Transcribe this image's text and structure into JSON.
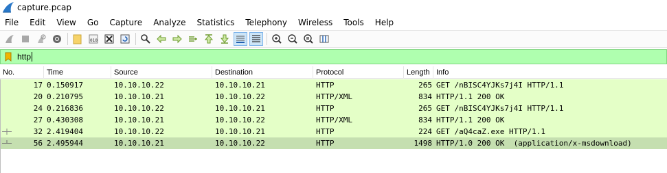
{
  "window": {
    "title": "capture.pcap"
  },
  "menu": [
    "File",
    "Edit",
    "View",
    "Go",
    "Capture",
    "Analyze",
    "Statistics",
    "Telephony",
    "Wireless",
    "Tools",
    "Help"
  ],
  "toolbar": {
    "icons": [
      "start-capture-icon",
      "stop-capture-icon",
      "restart-capture-icon",
      "capture-options-icon",
      "open-file-icon",
      "save-file-icon",
      "close-file-icon",
      "reload-file-icon",
      "find-packet-icon",
      "go-back-icon",
      "go-forward-icon",
      "go-to-packet-icon",
      "first-packet-icon",
      "last-packet-icon",
      "autoscroll-icon",
      "colorize-icon",
      "zoom-in-icon",
      "zoom-out-icon",
      "normal-size-icon",
      "resize-columns-icon"
    ]
  },
  "filter": {
    "value": "http"
  },
  "columns": [
    "No.",
    "Time",
    "Source",
    "Destination",
    "Protocol",
    "Length",
    "Info"
  ],
  "packets": [
    {
      "no": "17",
      "time": "0.150917",
      "source": "10.10.10.22",
      "destination": "10.10.10.21",
      "protocol": "HTTP",
      "length": "265",
      "info": "GET /nBISC4YJKs7j4I HTTP/1.1"
    },
    {
      "no": "20",
      "time": "0.210795",
      "source": "10.10.10.21",
      "destination": "10.10.10.22",
      "protocol": "HTTP/XML",
      "length": "834",
      "info": "HTTP/1.1 200 OK"
    },
    {
      "no": "24",
      "time": "0.216836",
      "source": "10.10.10.22",
      "destination": "10.10.10.21",
      "protocol": "HTTP",
      "length": "265",
      "info": "GET /nBISC4YJKs7j4I HTTP/1.1"
    },
    {
      "no": "27",
      "time": "0.430308",
      "source": "10.10.10.21",
      "destination": "10.10.10.22",
      "protocol": "HTTP/XML",
      "length": "834",
      "info": "HTTP/1.1 200 OK"
    },
    {
      "no": "32",
      "time": "2.419404",
      "source": "10.10.10.22",
      "destination": "10.10.10.21",
      "protocol": "HTTP",
      "length": "224",
      "info": "GET /aQ4caZ.exe HTTP/1.1"
    },
    {
      "no": "56",
      "time": "2.495944",
      "source": "10.10.10.21",
      "destination": "10.10.10.22",
      "protocol": "HTTP",
      "length": "1498",
      "info": "HTTP/1.0 200 OK  (application/x-msdownload)"
    }
  ],
  "colors": {
    "filter_valid": "#afffaf",
    "http_row": "#e4ffc7",
    "selected_row": "#c5dfb0"
  }
}
